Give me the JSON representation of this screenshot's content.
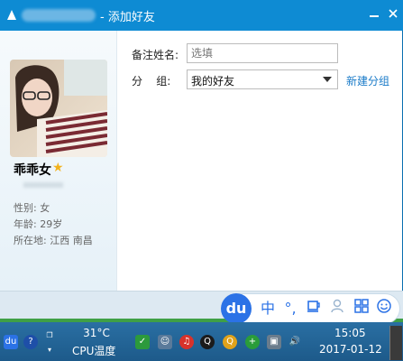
{
  "window": {
    "title": "- 添加好友",
    "minimize_icon": "minimize-icon",
    "close_icon": "close-icon"
  },
  "profile": {
    "nickname": "乖乖女",
    "gender_label": "性别:",
    "gender_value": "女",
    "age_label": "年龄:",
    "age_value": "29岁",
    "location_label": "所在地:",
    "location_value": "江西  南昌"
  },
  "form": {
    "remark_label": "备注姓名:",
    "remark_placeholder": "选填",
    "group_label": "分    组:",
    "group_value": "我的好友",
    "new_group_link": "新建分组"
  },
  "ime": {
    "logo": "du",
    "mode": "中",
    "punct": "°,",
    "icons": [
      "cup-icon",
      "user-icon",
      "grid-icon",
      "smiley-icon"
    ]
  },
  "taskbar": {
    "cpu_temp": "31°C",
    "cpu_label": "CPU温度",
    "time": "15:05",
    "date": "2017-01-12"
  }
}
